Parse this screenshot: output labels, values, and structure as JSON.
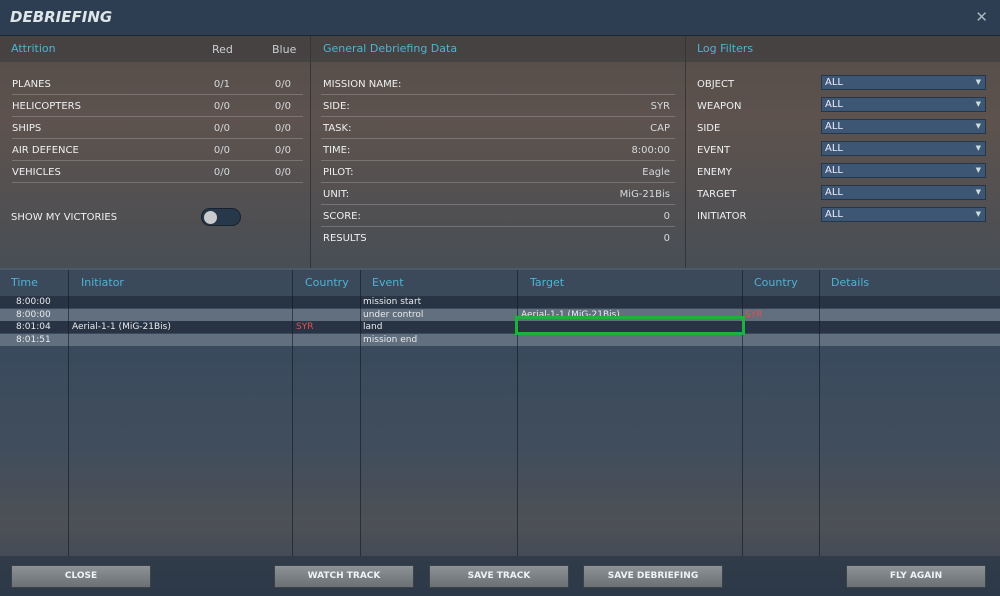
{
  "window": {
    "title": "DEBRIEFING",
    "close_icon": "close-icon"
  },
  "attrition": {
    "heading": "Attrition",
    "col_red": "Red",
    "col_blue": "Blue",
    "rows": [
      {
        "label": "PLANES",
        "red": "0/1",
        "blue": "0/0"
      },
      {
        "label": "HELICOPTERS",
        "red": "0/0",
        "blue": "0/0"
      },
      {
        "label": "SHIPS",
        "red": "0/0",
        "blue": "0/0"
      },
      {
        "label": "AIR DEFENCE",
        "red": "0/0",
        "blue": "0/0"
      },
      {
        "label": "VEHICLES",
        "red": "0/0",
        "blue": "0/0"
      }
    ],
    "show_victories_label": "SHOW MY VICTORIES",
    "show_victories_on": false
  },
  "general": {
    "heading": "General Debriefing Data",
    "rows": [
      {
        "label": "MISSION NAME:",
        "value": ""
      },
      {
        "label": "SIDE:",
        "value": "SYR"
      },
      {
        "label": "TASK:",
        "value": "CAP"
      },
      {
        "label": "TIME:",
        "value": "8:00:00"
      },
      {
        "label": "PILOT:",
        "value": "Eagle"
      },
      {
        "label": "UNIT:",
        "value": "MiG-21Bis"
      },
      {
        "label": "SCORE:",
        "value": "0"
      },
      {
        "label": "RESULTS",
        "value": "0"
      }
    ]
  },
  "filters": {
    "heading": "Log Filters",
    "rows": [
      {
        "label": "OBJECT",
        "value": "ALL"
      },
      {
        "label": "WEAPON",
        "value": "ALL"
      },
      {
        "label": "SIDE",
        "value": "ALL"
      },
      {
        "label": "EVENT",
        "value": "ALL"
      },
      {
        "label": "ENEMY",
        "value": "ALL"
      },
      {
        "label": "TARGET",
        "value": "ALL"
      },
      {
        "label": "INITIATOR",
        "value": "ALL"
      }
    ]
  },
  "log": {
    "headers": {
      "time": "Time",
      "initiator": "Initiator",
      "country": "Country",
      "event": "Event",
      "target": "Target",
      "target_country": "Country",
      "details": "Details"
    },
    "rows": [
      {
        "time": "8:00:00",
        "initiator": "",
        "country": "",
        "event": "mission start",
        "target": "",
        "target_country": "",
        "details": ""
      },
      {
        "time": "8:00:00",
        "initiator": "",
        "country": "",
        "event": "under control",
        "target": "Aerial-1-1 (MiG-21Bis)",
        "target_country": "SYR",
        "details": ""
      },
      {
        "time": "8:01:04",
        "initiator": "Aerial-1-1 (MiG-21Bis)",
        "country": "SYR",
        "event": "land",
        "target": "",
        "target_country": "",
        "details": ""
      },
      {
        "time": "8:01:51",
        "initiator": "",
        "country": "",
        "event": "mission end",
        "target": "",
        "target_country": "",
        "details": ""
      }
    ]
  },
  "buttons": {
    "close": "CLOSE",
    "watch_track": "WATCH TRACK",
    "save_track": "SAVE TRACK",
    "save_debriefing": "SAVE DEBRIEFING",
    "fly_again": "FLY AGAIN"
  },
  "colors": {
    "accent": "#4fb3d6",
    "red_side": "#e05050",
    "highlight": "#1fb040"
  }
}
